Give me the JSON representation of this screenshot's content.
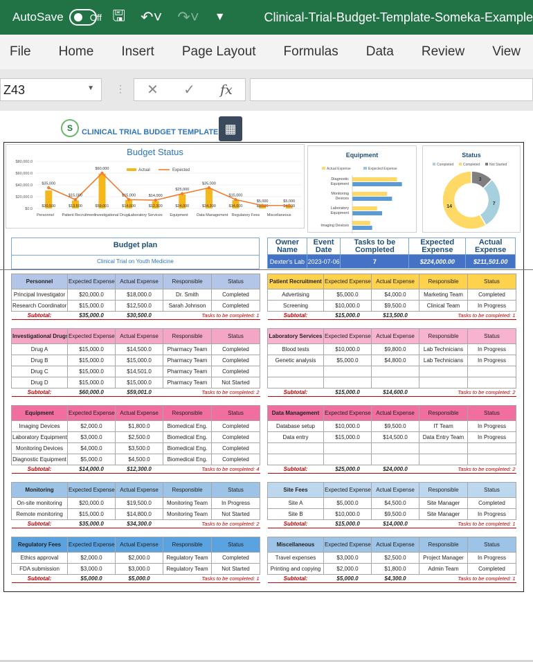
{
  "titlebar": {
    "autosave_label": "AutoSave",
    "toggle_state": "Off",
    "doc_title": "Clinical-Trial-Budget-Template-Someka-Example"
  },
  "ribbon": {
    "tabs": [
      "File",
      "Home",
      "Insert",
      "Page Layout",
      "Formulas",
      "Data",
      "Review",
      "View"
    ]
  },
  "formula_bar": {
    "cell_ref": "Z43",
    "formula": ""
  },
  "sheet_header": {
    "title": "CLINICAL TRIAL BUDGET TEMPLATE"
  },
  "colors": {
    "excel_green": "#217346",
    "accent_blue": "#2e75b6",
    "actual_bar": "#f4b71c",
    "expected_line": "#ed7d31",
    "equip_expected": "#5b9bd5",
    "status_completed": "#a6d0de",
    "status_progress": "#ffd966",
    "status_not_started": "#7f7f7f"
  },
  "chart_data": [
    {
      "type": "bar",
      "title": "Budget Status",
      "legend": [
        "Actual",
        "Expected"
      ],
      "legend_position": "top-right",
      "categories": [
        "Personnel",
        "Patient Recruitment",
        "Investigational Drugs",
        "Laboratory Services",
        "Equipment",
        "Data Management",
        "Regulatory Fees",
        "Miscellaneous"
      ],
      "series": [
        {
          "name": "Actual",
          "type": "bar",
          "values": [
            30500,
            13500,
            59001,
            14600,
            12300,
            24000,
            34300,
            14000,
            5000,
            4300
          ]
        },
        {
          "name": "Expected",
          "type": "line",
          "values": [
            35000,
            15000,
            60000,
            15000,
            14000,
            25000,
            35000,
            15000,
            5000,
            5000
          ]
        }
      ],
      "actual_labels": [
        "$30,500",
        "$13,500",
        "$59,001",
        "$14,600",
        "$12,300",
        "$24,000",
        "$34,300",
        "$14,000",
        "$5,000",
        "$4,300"
      ],
      "expected_labels": [
        "$35,000",
        "$15,000",
        "$60,000",
        "$15,000",
        "$14,000",
        "$25,000",
        "$35,000",
        "$15,000",
        "$5,000",
        "$5,000"
      ],
      "yticks": [
        "$0.0",
        "$20,000.0",
        "$40,000.0",
        "$60,000.0",
        "$80,000.0"
      ],
      "ylim": [
        0,
        80000
      ],
      "grid": true
    },
    {
      "type": "bar",
      "orientation": "horizontal",
      "title": "Equipment",
      "legend": [
        "Actual Expense",
        "Expected Expense"
      ],
      "legend_position": "top",
      "categories": [
        "Diagnostic Equipment",
        "Monitoring Devices",
        "Laboratory Equipment",
        "Imaging Devices"
      ],
      "series": [
        {
          "name": "Actual Expense",
          "values": [
            4500,
            3500,
            2500,
            1800
          ]
        },
        {
          "name": "Expected Expense",
          "values": [
            5000,
            4000,
            3000,
            2000
          ]
        }
      ],
      "xlim": [
        0,
        6000
      ]
    },
    {
      "type": "pie",
      "title": "Status",
      "legend": [
        "Completed",
        "Completed",
        "Not Started"
      ],
      "legend_position": "top",
      "labels": [
        "Not Started",
        "Completed",
        "In Progress"
      ],
      "values": [
        3,
        7,
        14
      ]
    }
  ],
  "budget_plan": {
    "title": "Budget plan",
    "subtitle": "Clinical Trial on Youth Medicine"
  },
  "summary": {
    "headers": [
      "Owner Name",
      "Event Date",
      "Tasks to be Completed",
      "Expected Expense",
      "Actual Expense"
    ],
    "values": [
      "Dexter's Lab",
      "2023-07-06",
      "7",
      "$224,000.00",
      "$211,501.00"
    ]
  },
  "table_headers": [
    "Expected Expense",
    "Actual Expense",
    "Responsible",
    "Status"
  ],
  "subtotal_label": "Subtotal:",
  "sections_left": [
    {
      "name": "Personnel",
      "color": "#b4c6e7",
      "rows": [
        [
          "Principal Investigator",
          "$20,000.0",
          "$18,000.0",
          "Dr. Smith",
          "Completed"
        ],
        [
          "Research Coordinator",
          "$15,000.0",
          "$12,500.0",
          "Sarah Johnson",
          "Completed"
        ]
      ],
      "subtotal": [
        "$35,000.0",
        "$30,500.0"
      ],
      "tasks": "Tasks to be completed: 1"
    },
    {
      "name": "Investigational Drugs",
      "color": "#f4a6c6",
      "rows": [
        [
          "Drug A",
          "$15,000.0",
          "$14,500.0",
          "Pharmacy Team",
          "Completed"
        ],
        [
          "Drug B",
          "$15,000.0",
          "$15,000.0",
          "Pharmacy Team",
          "Completed"
        ],
        [
          "Drug C",
          "$15,000.0",
          "$14,501.0",
          "Pharmacy Team",
          "Completed"
        ],
        [
          "Drug D",
          "$15,000.0",
          "$15,000.0",
          "Pharmacy Team",
          "Not Started"
        ]
      ],
      "subtotal": [
        "$60,000.0",
        "$59,001.0"
      ],
      "tasks": "Tasks to be completed: 2"
    },
    {
      "name": "Equipment",
      "color": "#f06ea0",
      "rows": [
        [
          "Imaging Devices",
          "$2,000.0",
          "$1,800.0",
          "Biomedical Eng.",
          "Completed"
        ],
        [
          "Laboratory Equipment",
          "$3,000.0",
          "$2,500.0",
          "Biomedical Eng.",
          "Completed"
        ],
        [
          "Monitoring Devices",
          "$4,000.0",
          "$3,500.0",
          "Biomedical Eng.",
          "Completed"
        ],
        [
          "Diagnostic Equipment",
          "$5,000.0",
          "$4,500.0",
          "Biomedical Eng.",
          "Completed"
        ]
      ],
      "subtotal": [
        "$14,000.0",
        "$12,300.0"
      ],
      "tasks": "Tasks to be completed: 4"
    },
    {
      "name": "Monitoring",
      "color": "#9dc3e6",
      "rows": [
        [
          "On-site monitoring",
          "$20,000.0",
          "$19,500.0",
          "Monitoring Team",
          "In Progress"
        ],
        [
          "Remote monitoring",
          "$15,000.0",
          "$14,800.0",
          "Monitoring Team",
          "Not Started"
        ]
      ],
      "subtotal": [
        "$35,000.0",
        "$34,300.0"
      ],
      "tasks": "Tasks to be completed: 2"
    },
    {
      "name": "Regulatory Fees",
      "color": "#5ba3e0",
      "rows": [
        [
          "Ethics approval",
          "$2,000.0",
          "$2,000.0",
          "Regulatory Team",
          "Completed"
        ],
        [
          "FDA submission",
          "$3,000.0",
          "$3,000.0",
          "Regulatory Team",
          "Not Started"
        ]
      ],
      "subtotal": [
        "$5,000.0",
        "$5,000.0"
      ],
      "tasks": "Tasks to be completed: 1"
    }
  ],
  "sections_right": [
    {
      "name": "Patient Recruitment",
      "color": "#ffd24d",
      "rows": [
        [
          "Advertising",
          "$5,000.0",
          "$4,000.0",
          "Marketing Team",
          "Completed"
        ],
        [
          "Screening",
          "$10,000.0",
          "$9,500.0",
          "Clinical Team",
          "In Progress"
        ]
      ],
      "subtotal": [
        "$15,000.0",
        "$13,500.0"
      ],
      "tasks": "Tasks to be completed: 1"
    },
    {
      "name": "Laboratory Services",
      "color": "#f7b3cf",
      "rows": [
        [
          "Blood tests",
          "$10,000.0",
          "$9,800.0",
          "Lab Technicians",
          "In Progress"
        ],
        [
          "Genetic analysis",
          "$5,000.0",
          "$4,800.0",
          "Lab Technicians",
          "In Progress"
        ],
        [
          "",
          "",
          "",
          "",
          ""
        ],
        [
          "",
          "",
          "",
          "",
          ""
        ]
      ],
      "subtotal": [
        "$15,000.0",
        "$14,600.0"
      ],
      "tasks": "Tasks to be completed: 2"
    },
    {
      "name": "Data Management",
      "color": "#f06ea0",
      "rows": [
        [
          "Database setup",
          "$10,000.0",
          "$9,500.0",
          "IT Team",
          "In Progress"
        ],
        [
          "Data entry",
          "$15,000.0",
          "$14,500.0",
          "Data Entry Team",
          "In Progress"
        ],
        [
          "",
          "",
          "",
          "",
          ""
        ],
        [
          "",
          "",
          "",
          "",
          ""
        ]
      ],
      "subtotal": [
        "$25,000.0",
        "$24,000.0"
      ],
      "tasks": "Tasks to be completed: 2"
    },
    {
      "name": "Site Fees",
      "color": "#bdd7ee",
      "rows": [
        [
          "Site A",
          "$5,000.0",
          "$4,500.0",
          "Site Manager",
          "Completed"
        ],
        [
          "Site B",
          "$10,000.0",
          "$9,500.0",
          "Site Manager",
          "In Progress"
        ]
      ],
      "subtotal": [
        "$15,000.0",
        "$14,000.0"
      ],
      "tasks": "Tasks to be completed: 1"
    },
    {
      "name": "Miscellaneous",
      "color": "#9dc3e6",
      "rows": [
        [
          "Travel expenses",
          "$3,000.0",
          "$2,500.0",
          "Project Manager",
          "In Progress"
        ],
        [
          "Printing and copying",
          "$2,000.0",
          "$1,800.0",
          "Admin Team",
          "Completed"
        ]
      ],
      "subtotal": [
        "$5,000.0",
        "$4,300.0"
      ],
      "tasks": "Tasks to be completed: 1"
    }
  ]
}
